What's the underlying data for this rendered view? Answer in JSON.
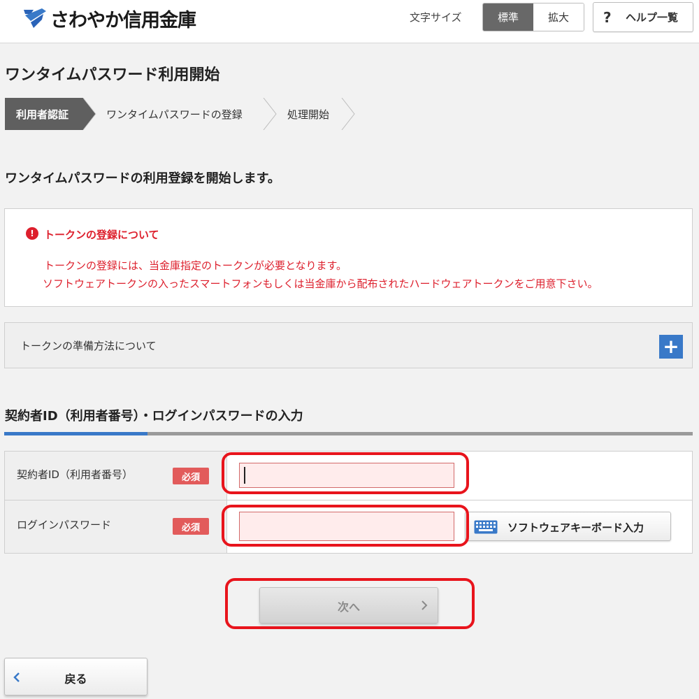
{
  "header": {
    "logo_text": "さわやか信用金庫",
    "fontsize_label": "文字サイズ",
    "fontsize_standard": "標準",
    "fontsize_large": "拡大",
    "help_icon": "?",
    "help_label": "ヘルプ一覧"
  },
  "page": {
    "title": "ワンタイムパスワード利用開始",
    "steps": [
      {
        "label": "利用者認証",
        "active": true
      },
      {
        "label": "ワンタイムパスワードの登録",
        "active": false
      },
      {
        "label": "処理開始",
        "active": false
      }
    ],
    "lead": "ワンタイムパスワードの利用登録を開始します。"
  },
  "notice": {
    "icon": "!",
    "title": "トークンの登録について",
    "line1": "トークンの登録には、当金庫指定のトークンが必要となります。",
    "line2": "ソフトウェアトークンの入ったスマートフォンもしくは当金庫から配布されたハードウェアトークンをご用意下さい。"
  },
  "accordion": {
    "label": "トークンの準備方法について",
    "toggle_icon": "+"
  },
  "form": {
    "section_title": "契約者ID（利用者番号）・ログインパスワードの入力",
    "contract_id_label": "契約者ID（利用者番号）",
    "contract_id_value": "",
    "password_label": "ログインパスワード",
    "password_value": "",
    "required_badge": "必須",
    "keyboard_button": "ソフトウェアキーボード入力"
  },
  "actions": {
    "next": "次へ",
    "back": "戻る"
  },
  "colors": {
    "accent_blue": "#3979c8",
    "alert_red": "#dd1f2c",
    "highlight_red": "#e8141c",
    "required_badge": "#e25b5b",
    "input_bg": "#ffecec"
  }
}
